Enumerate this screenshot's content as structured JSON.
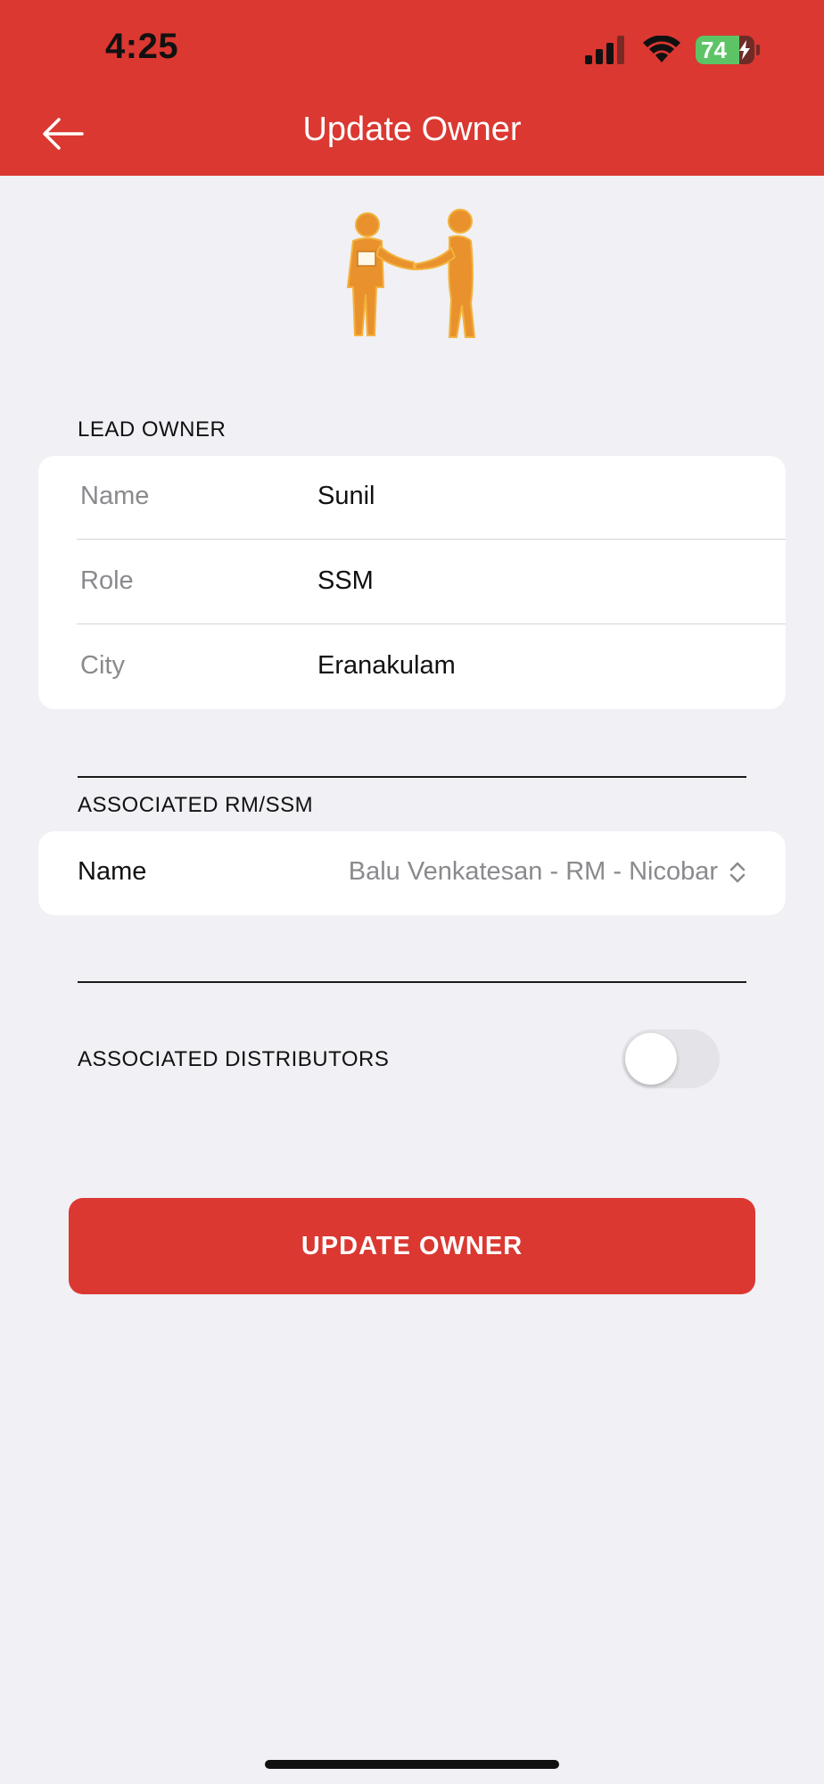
{
  "status_bar": {
    "time": "4:25",
    "battery_level": "74",
    "battery_fraction": 0.74,
    "icons": [
      "signal-icon",
      "wifi-icon",
      "battery-icon",
      "charging-bolt-icon"
    ]
  },
  "nav": {
    "title": "Update Owner",
    "back_icon": "arrow-left-icon"
  },
  "hero_icon": "handshake-people-icon",
  "lead_owner": {
    "section_title": "LEAD OWNER",
    "rows": [
      {
        "label": "Name",
        "value": "Sunil"
      },
      {
        "label": "Role",
        "value": "SSM"
      },
      {
        "label": "City",
        "value": "Eranakulam"
      }
    ]
  },
  "associated_rm": {
    "section_title": "ASSOCIATED RM/SSM",
    "field_label": "Name",
    "selected_value": "Balu Venkatesan - RM - Nicobar",
    "chevron_icon": "chevron-up-down-icon"
  },
  "associated_distributors": {
    "label": "ASSOCIATED DISTRIBUTORS",
    "toggle_on": false
  },
  "actions": {
    "update_button": "UPDATE OWNER"
  },
  "colors": {
    "brand_red": "#da3831",
    "background": "#f0f0f5",
    "battery_green": "#5dc466",
    "hero_orange": "#e8912d"
  }
}
